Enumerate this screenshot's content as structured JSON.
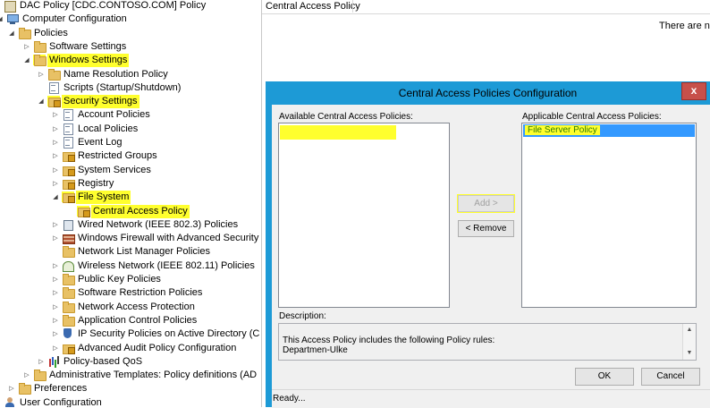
{
  "tree": {
    "items": [
      {
        "label": "DAC Policy [CDC.CONTOSO.COM] Policy",
        "icon": "gpo-icon",
        "toggle": "",
        "highlight": false
      },
      {
        "label": "Computer Configuration",
        "icon": "computer-icon",
        "toggle": "◢",
        "highlight": false
      },
      {
        "label": "Policies",
        "icon": "folder-icon",
        "toggle": "◢",
        "highlight": false
      },
      {
        "label": "Software Settings",
        "icon": "folder-icon",
        "toggle": "▷",
        "highlight": false
      },
      {
        "label": "Windows Settings",
        "icon": "folder-icon",
        "toggle": "◢",
        "highlight": true
      },
      {
        "label": "Name Resolution Policy",
        "icon": "folder-icon",
        "toggle": "▷",
        "highlight": false
      },
      {
        "label": "Scripts (Startup/Shutdown)",
        "icon": "document-icon",
        "toggle": "",
        "highlight": false
      },
      {
        "label": "Security Settings",
        "icon": "security-folder-icon",
        "toggle": "◢",
        "highlight": true
      },
      {
        "label": "Account Policies",
        "icon": "document-icon",
        "toggle": "▷",
        "highlight": false
      },
      {
        "label": "Local Policies",
        "icon": "document-icon",
        "toggle": "▷",
        "highlight": false
      },
      {
        "label": "Event Log",
        "icon": "document-icon",
        "toggle": "▷",
        "highlight": false
      },
      {
        "label": "Restricted Groups",
        "icon": "security-folder-icon",
        "toggle": "▷",
        "highlight": false
      },
      {
        "label": "System Services",
        "icon": "security-folder-icon",
        "toggle": "▷",
        "highlight": false
      },
      {
        "label": "Registry",
        "icon": "security-folder-icon",
        "toggle": "▷",
        "highlight": false
      },
      {
        "label": "File System",
        "icon": "security-folder-icon",
        "toggle": "◢",
        "highlight": true
      },
      {
        "label": "Central Access Policy",
        "icon": "security-folder-icon",
        "toggle": "",
        "highlight": true
      },
      {
        "label": "Wired Network (IEEE 802.3) Policies",
        "icon": "network-icon",
        "toggle": "▷",
        "highlight": false
      },
      {
        "label": "Windows Firewall with Advanced Security",
        "icon": "firewall-icon",
        "toggle": "▷",
        "highlight": false
      },
      {
        "label": "Network List Manager Policies",
        "icon": "folder-icon",
        "toggle": "",
        "highlight": false
      },
      {
        "label": "Wireless Network (IEEE 802.11) Policies",
        "icon": "wireless-icon",
        "toggle": "▷",
        "highlight": false
      },
      {
        "label": "Public Key Policies",
        "icon": "folder-icon",
        "toggle": "▷",
        "highlight": false
      },
      {
        "label": "Software Restriction Policies",
        "icon": "folder-icon",
        "toggle": "▷",
        "highlight": false
      },
      {
        "label": "Network Access Protection",
        "icon": "folder-icon",
        "toggle": "▷",
        "highlight": false
      },
      {
        "label": "Application Control Policies",
        "icon": "folder-icon",
        "toggle": "▷",
        "highlight": false
      },
      {
        "label": "IP Security Policies on Active Directory (C",
        "icon": "shield-icon",
        "toggle": "▷",
        "highlight": false
      },
      {
        "label": "Advanced Audit Policy Configuration",
        "icon": "security-folder-icon",
        "toggle": "▷",
        "highlight": false
      },
      {
        "label": "Policy-based QoS",
        "icon": "chart-icon",
        "toggle": "▷",
        "highlight": false
      },
      {
        "label": "Administrative Templates: Policy definitions (AD",
        "icon": "folder-icon",
        "toggle": "▷",
        "highlight": false
      },
      {
        "label": "Preferences",
        "icon": "folder-icon",
        "toggle": "▷",
        "highlight": false
      },
      {
        "label": "User Configuration",
        "icon": "user-icon",
        "toggle": "▷",
        "highlight": false
      }
    ]
  },
  "right_pane": {
    "column_header": "Central Access Policy",
    "empty_message": "There are no"
  },
  "dialog": {
    "title": "Central Access Policies Configuration",
    "close_label": "x",
    "available_label": "Available Central Access Policies:",
    "available_items": [
      ""
    ],
    "applicable_label": "Applicable Central Access Policies:",
    "applicable_items": [
      "File Server Policy"
    ],
    "add_button": "Add >",
    "remove_button": "< Remove",
    "description_label": "Description:",
    "description_lines": [
      "This Access Policy includes the following Policy rules:",
      "Departmen-Ulke"
    ],
    "ok_button": "OK",
    "cancel_button": "Cancel",
    "status": "Ready..."
  },
  "colors": {
    "highlight": "#ffff2e",
    "dialog_frame": "#1d9ad6",
    "selection": "#3399ff",
    "close_button": "#c7504a"
  }
}
